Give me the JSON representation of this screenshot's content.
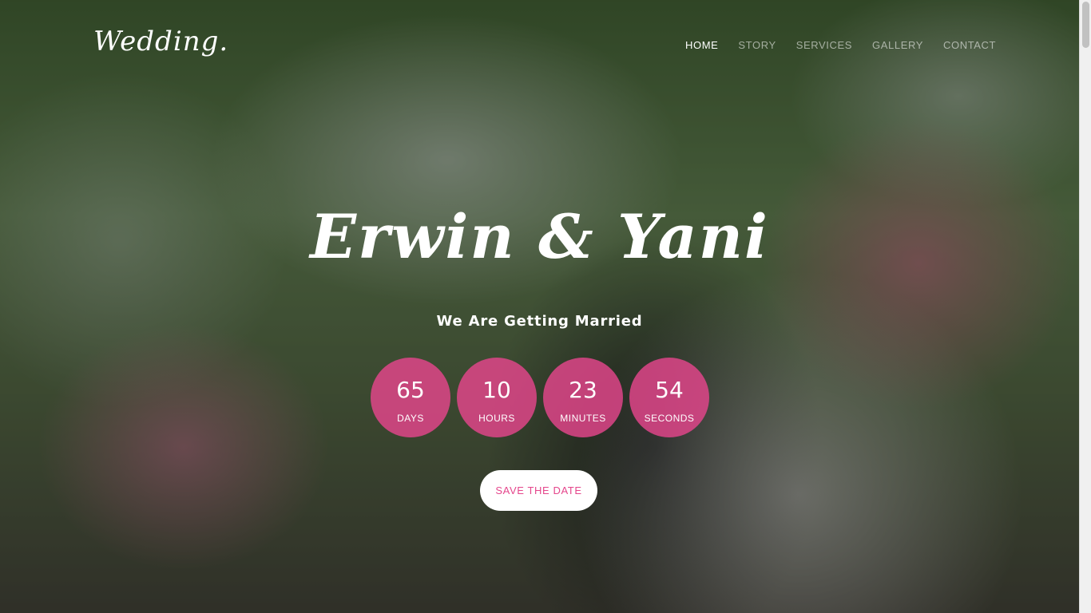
{
  "brand": {
    "logo_text": "Wedding."
  },
  "nav": {
    "items": [
      {
        "label": "HOME",
        "active": true
      },
      {
        "label": "STORY"
      },
      {
        "label": "SERVICES"
      },
      {
        "label": "GALLERY"
      },
      {
        "label": "CONTACT"
      }
    ]
  },
  "hero": {
    "couple": "Erwin & Yani",
    "subtitle": "We Are Getting Married",
    "countdown": [
      {
        "value": "65",
        "unit": "DAYS"
      },
      {
        "value": "10",
        "unit": "HOURS"
      },
      {
        "value": "23",
        "unit": "MINUTES"
      },
      {
        "value": "54",
        "unit": "SECONDS"
      }
    ],
    "cta_label": "SAVE THE DATE"
  },
  "colors": {
    "accent": "#e5468c",
    "text": "#ffffff",
    "button_bg": "#ffffff"
  }
}
